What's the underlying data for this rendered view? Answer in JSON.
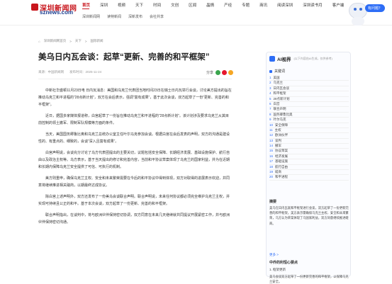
{
  "logo": {
    "line1": "深圳新闻网",
    "line2": "sznews.com"
  },
  "nav": [
    "首页",
    "深圳",
    "视频",
    "天下",
    "时间",
    "文创",
    "区闻",
    "晶情",
    "产经",
    "专题",
    "商讯",
    "阅读深圳",
    "深圳读书月",
    "客户端"
  ],
  "subnav": [
    "深圳新闻网",
    "读特新闻",
    "深新发布",
    "会社共享"
  ],
  "bubble": "有问题？",
  "breadcrumb": [
    "深圳新闻网首页",
    ">",
    "天下",
    ">",
    "国际新闻"
  ],
  "title": "美乌日内瓦会谈：起草“更新、完善的和平框架”",
  "meta": {
    "source": "来源：中国新闻网",
    "time": "发布时间：2025-11-24"
  },
  "share_label": "分享",
  "article": [
    "中新社华盛顿11月23日电 日内瓦消息：美国和乌克兰代表团当地时间23日在瑞士日内瓦举行会谈，讨论美方提出的旨在推动乌克兰和平进程的“28点新计划”，双方在会后表示，强调“富有成果”，基于此次会谈，双方起草了一份“更新、完善的和平框架”。",
    "近日，据国多家媒体报道称，白宫起草了一份旨在推动乌克兰和平进程的“28点新计划”。该计划涉及要求乌克兰从其目前控制的领土撤军、限制军队规模等方面的条件。",
    "当天，美国国务卿鲁比奥和乌克兰总统办公室主任叶尔马克参加会谈。根据白宫在会后发表的声明，双方的沟通是建设性的、有重点的、细致的，会谈“深入且富有成果”。",
    "白宫声明说，会谈充分讨论了乌方代表团提出的主要关切，议题包括安全保障、长期经济发展、基础设施保护、航行自由以及政治主权等。乌方表示，基于当天提出的修订和完善内容，当前和平协议草案体现了乌克兰的国家利益，并为在近期和长期内保障乌克兰安全提供了可信、可执行的机制。",
    "美方则重申，确保乌克兰主权、安全和未来繁荣需要在今后的和平协议中得到体现，双方对取得的进展表示欢迎，并同意将继续推进相关磋商，以期最终达成协议。",
    "除白宫上述声明外，双方还发布了一份美乌会谈联合声明。联合声明说，未来任何协议都必须完全维护乌克兰主权，并实现可持续且公正的和平。基于本次会谈，双方起草了一份更新、完善的和平框架。",
    "联合声明指出，在谈判中，将与欧洲伙伴保持密切协调，双方同意在未来几天继续就共同提议开展紧密工作，并与欧洲伙伴保持密切沟通。"
  ],
  "sidebar": {
    "ai_title": "AI视界",
    "ai_sub": "(以下内容由AI生成，仅供参考)",
    "keywords_label": "关键词",
    "keywords": [
      {
        "num": "1",
        "text": "美国"
      },
      {
        "num": "2",
        "text": "乌克兰"
      },
      {
        "num": "3",
        "text": "日内瓦会谈"
      },
      {
        "num": "4",
        "text": "和平框架"
      },
      {
        "num": "5",
        "text": "28点新计划"
      },
      {
        "num": "6",
        "text": "白宫"
      },
      {
        "num": "7",
        "text": "联合声明"
      },
      {
        "num": "8",
        "text": "国务卿鲁比奥"
      },
      {
        "num": "9",
        "text": "叶尔马克"
      },
      {
        "num": "10",
        "text": "安全保障"
      },
      {
        "num": "11",
        "text": "主权"
      },
      {
        "num": "12",
        "text": "欧洲伙伴"
      },
      {
        "num": "13",
        "text": "谈判"
      },
      {
        "num": "14",
        "text": "撤军"
      },
      {
        "num": "15",
        "text": "协议草案"
      },
      {
        "num": "16",
        "text": "经济发展"
      },
      {
        "num": "17",
        "text": "基础设施"
      },
      {
        "num": "18",
        "text": "航行自由"
      },
      {
        "num": "19",
        "text": "磋商"
      },
      {
        "num": "20",
        "text": "和平进程"
      }
    ],
    "summary_title": "摘要",
    "summary": "美乌在日内瓦就和平框架进行会谈，双方起草了一份更新完善的和平框架，美方表示需确保乌克兰主权、安全和未来繁荣，乌方认为草案体现了乌国家利益，双方同意继续推进磋商。",
    "more_label": "更多 >",
    "key_points_label": "中乔的利恒心要点",
    "key_item": "1. 框架更新",
    "key_text": "美乌会谈双方起草了一份更新完善的和平框架，以保障乌克兰安全。"
  }
}
